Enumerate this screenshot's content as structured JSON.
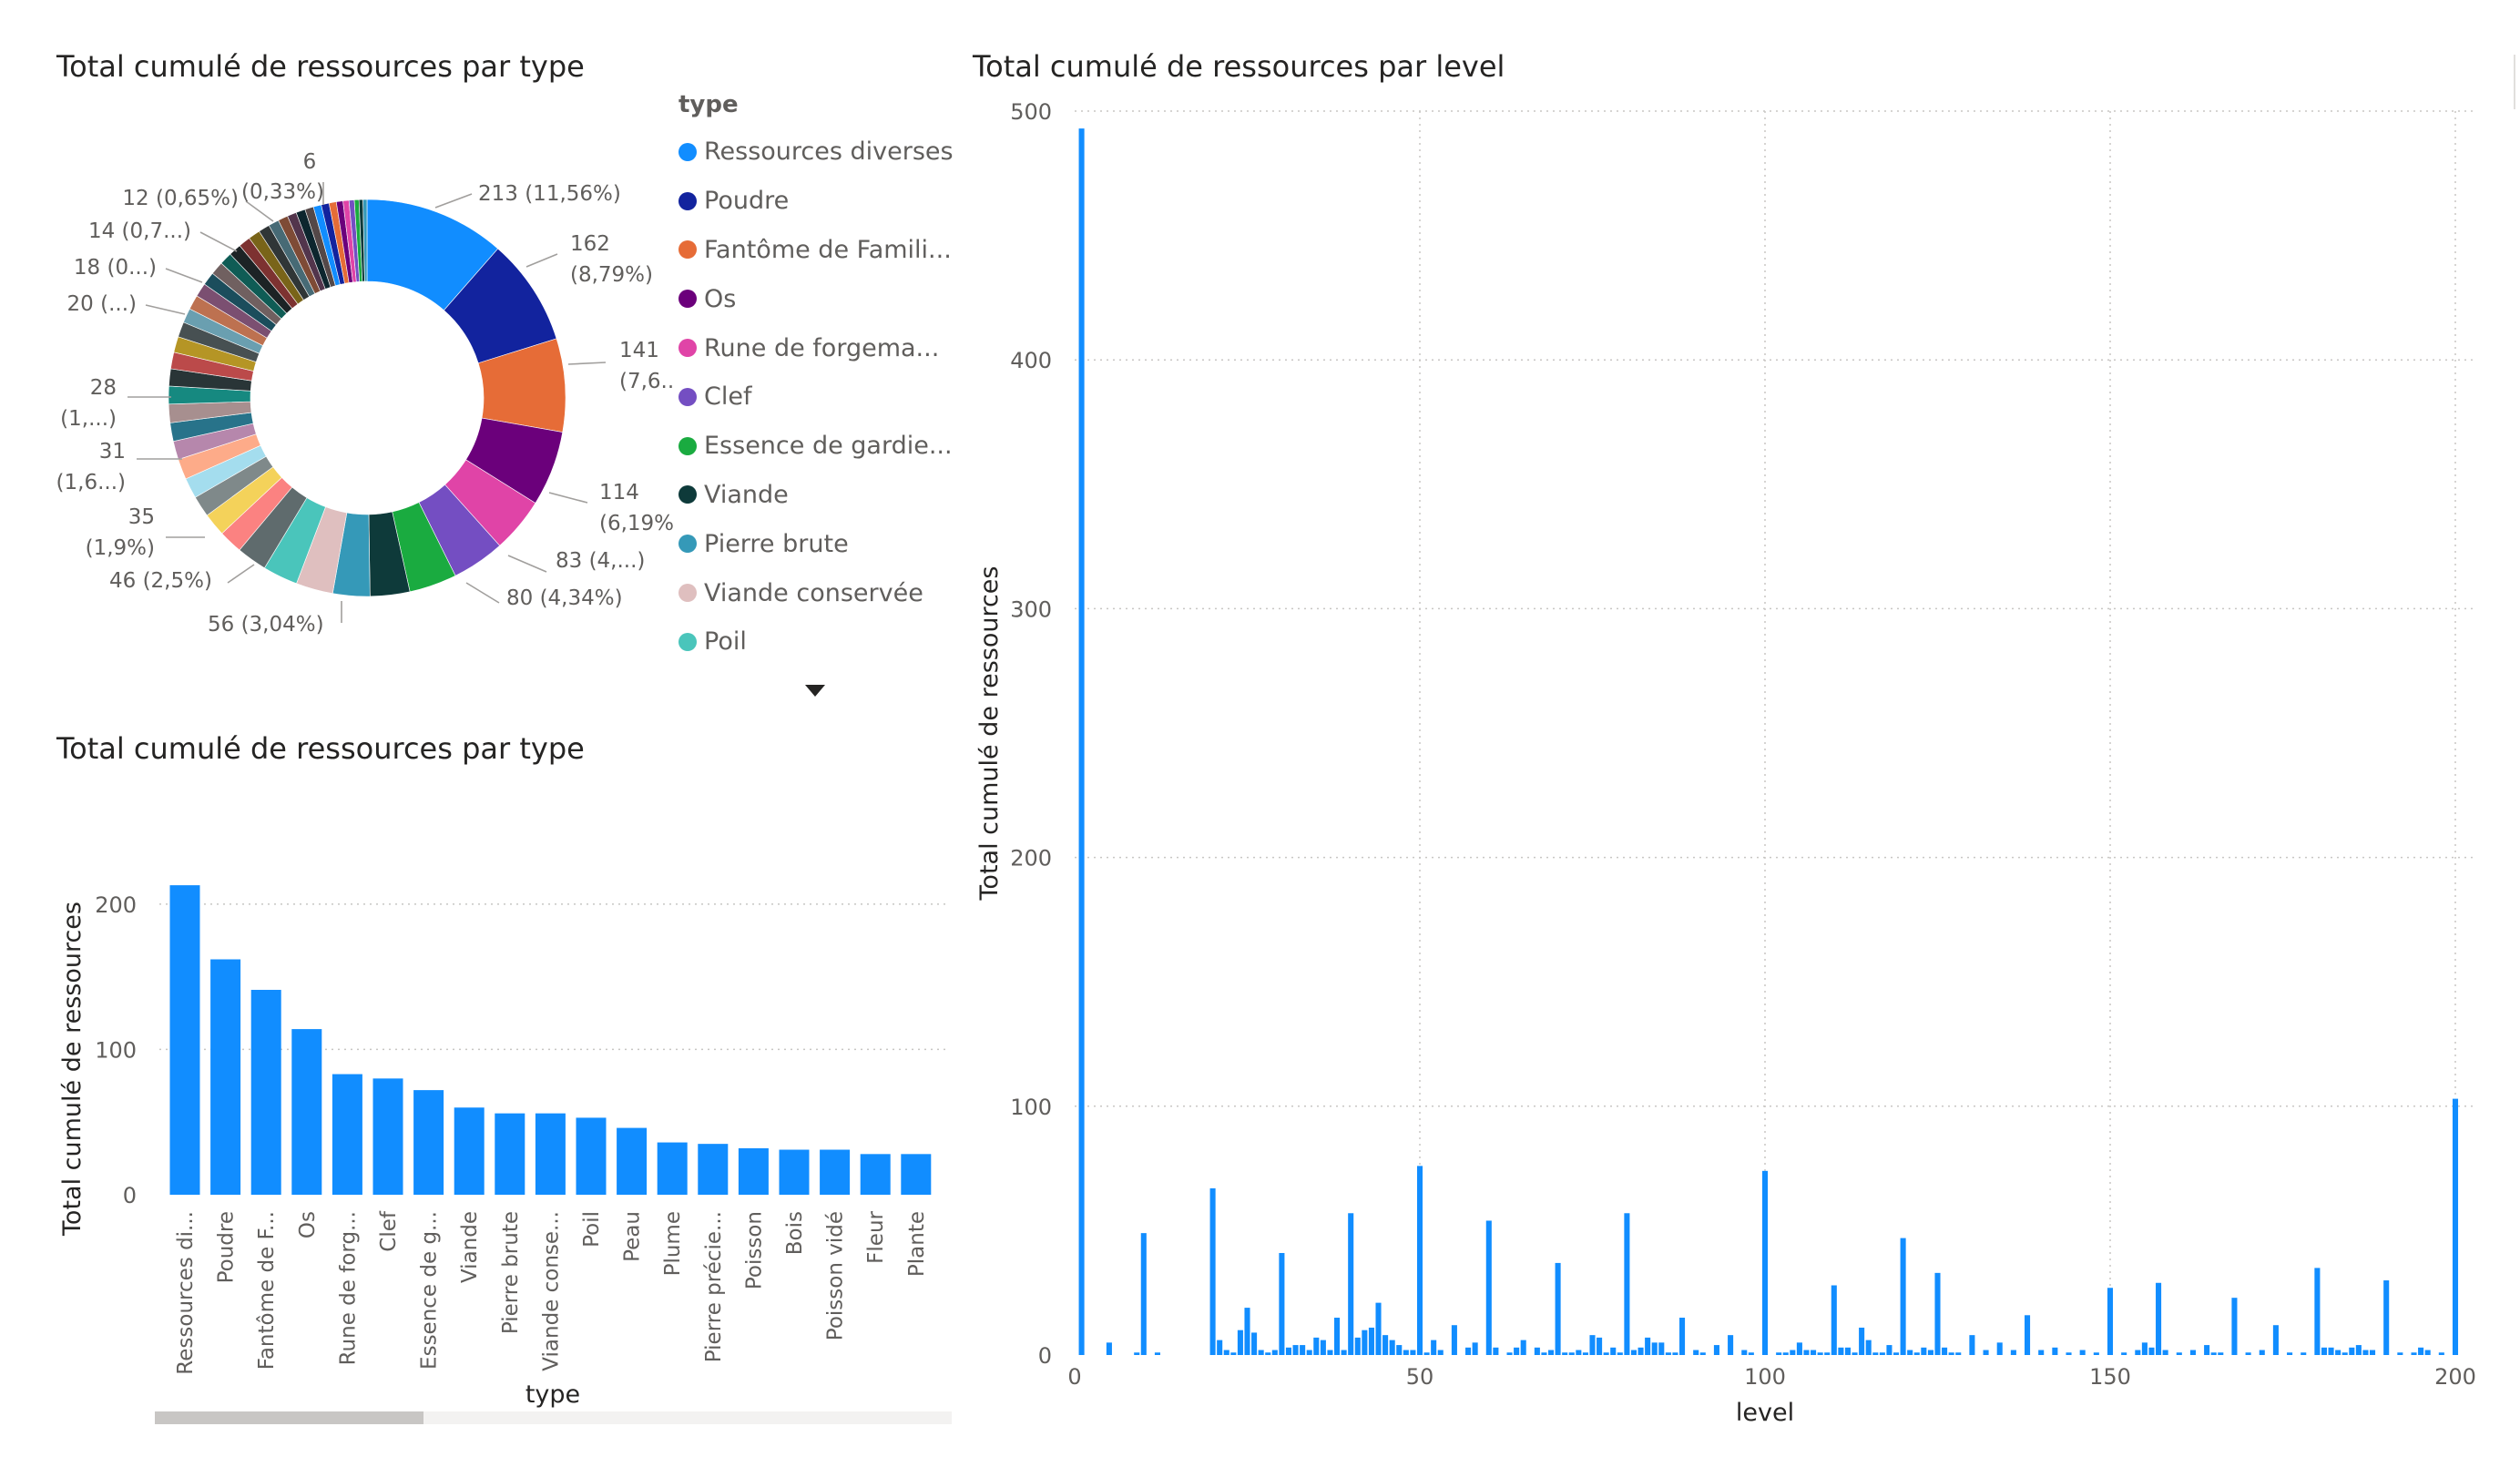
{
  "donut": {
    "title": "Total cumulé de ressources par type",
    "legend_title": "type",
    "legend_items": [
      {
        "label": "Ressources diverses",
        "color": "#118DFF"
      },
      {
        "label": "Poudre",
        "color": "#12239E"
      },
      {
        "label": "Fantôme de Famili...",
        "color": "#E66C37"
      },
      {
        "label": "Os",
        "color": "#6B007B"
      },
      {
        "label": "Rune de forgema...",
        "color": "#E044A7"
      },
      {
        "label": "Clef",
        "color": "#744EC2"
      },
      {
        "label": "Essence de gardie...",
        "color": "#1AAB40"
      },
      {
        "label": "Viande",
        "color": "#0E3A3A"
      },
      {
        "label": "Pierre brute",
        "color": "#3599B8"
      },
      {
        "label": "Viande conservée",
        "color": "#DFBFBF"
      },
      {
        "label": "Poil",
        "color": "#4AC5BB"
      }
    ],
    "labels": [
      {
        "lines": [
          "213 (11,56%)"
        ]
      },
      {
        "lines": [
          "162",
          "(8,79%)"
        ]
      },
      {
        "lines": [
          "141",
          "(7,6...)"
        ]
      },
      {
        "lines": [
          "114",
          "(6,19%)"
        ]
      },
      {
        "lines": [
          "83 (4,...)"
        ]
      },
      {
        "lines": [
          "80 (4,34%)"
        ]
      },
      {
        "lines": [
          "56 (3,04%)"
        ]
      },
      {
        "lines": [
          "46 (2,5%)"
        ]
      },
      {
        "lines": [
          "35",
          "(1,9%)"
        ]
      },
      {
        "lines": [
          "31",
          "(1,6...)"
        ]
      },
      {
        "lines": [
          "28",
          "(1,...)"
        ]
      },
      {
        "lines": [
          "20 (...)"
        ]
      },
      {
        "lines": [
          "18 (0...)"
        ]
      },
      {
        "lines": [
          "14 (0,7...)"
        ]
      },
      {
        "lines": [
          "12 (0,65%)"
        ]
      },
      {
        "lines": [
          "(0,33%)"
        ]
      },
      {
        "lines": [
          "6"
        ]
      }
    ]
  },
  "bar_type": {
    "title": "Total cumulé de ressources par type",
    "y_ticks": [
      "0",
      "100",
      "200"
    ]
  },
  "bar_level": {
    "title": "Total cumulé de ressources par level",
    "y_ticks": [
      "0",
      "100",
      "200",
      "300",
      "400",
      "500"
    ],
    "x_ticks": [
      "0",
      "50",
      "100",
      "150",
      "200"
    ]
  },
  "chart_data": [
    {
      "type": "pie",
      "title": "Total cumulé de ressources par type",
      "legend_title": "type",
      "categories": [
        "Ressources diverses",
        "Poudre",
        "Fantôme de Famili...",
        "Os",
        "Rune de forgema...",
        "Clef",
        "Essence de gardie...",
        "Viande",
        "Pierre brute",
        "Viande conservée",
        "Poil"
      ],
      "values": [
        213,
        162,
        141,
        114,
        83,
        80,
        72,
        60,
        56,
        56,
        53,
        46,
        36,
        35,
        32,
        31,
        31,
        28,
        28,
        28,
        27,
        26,
        25,
        24,
        23,
        22,
        22,
        21,
        20,
        20,
        19,
        19,
        18,
        18,
        17,
        16,
        15,
        14,
        14,
        13,
        12,
        12,
        11,
        10,
        9,
        8,
        7,
        6,
        6
      ],
      "colors": [
        "#118DFF",
        "#12239E",
        "#E66C37",
        "#6B007B",
        "#E044A7",
        "#744EC2",
        "#1AAB40",
        "#0E3A3A",
        "#3599B8",
        "#DFBFBF",
        "#4AC5BB",
        "#5F6B6D",
        "#FB8281",
        "#F4D25A",
        "#7F898A",
        "#A4DDEE",
        "#FDAB89",
        "#B687AC",
        "#28738A",
        "#A78F8F",
        "#168980",
        "#293537",
        "#BB4A4A",
        "#B59525",
        "#475052",
        "#6A9FB0",
        "#BD7150",
        "#7B4F71",
        "#1B4D5C",
        "#706060",
        "#0F5C55",
        "#1C2325",
        "#7D3231",
        "#796419",
        "#303637",
        "#476A75",
        "#7E4B36",
        "#52354C",
        "#0D262E",
        "#544848",
        "#118DFF",
        "#12239E",
        "#E66C37",
        "#6B007B",
        "#E044A7",
        "#744EC2",
        "#1AAB40",
        "#0E3A3A",
        "#3599B8"
      ]
    },
    {
      "type": "bar",
      "title": "Total cumulé de ressources par type",
      "xlabel": "type",
      "ylabel": "Total cumulé de ressources",
      "categories": [
        "Ressources di...",
        "Poudre",
        "Fantôme de F...",
        "Os",
        "Rune de forg...",
        "Clef",
        "Essence de g...",
        "Viande",
        "Pierre brute",
        "Viande conse...",
        "Poil",
        "Peau",
        "Plume",
        "Pierre précie...",
        "Poisson",
        "Bois",
        "Poisson vidé",
        "Fleur",
        "Plante"
      ],
      "values": [
        213,
        162,
        141,
        114,
        83,
        80,
        72,
        60,
        56,
        56,
        53,
        46,
        36,
        35,
        32,
        31,
        31,
        28,
        28
      ],
      "ylim": [
        0,
        230
      ],
      "color": "#118DFF",
      "grid": true
    },
    {
      "type": "bar",
      "title": "Total cumulé de ressources par level",
      "xlabel": "level",
      "ylabel": "Total cumulé de ressources",
      "x": [
        1,
        5,
        9,
        10,
        12,
        20,
        21,
        22,
        23,
        24,
        25,
        26,
        27,
        28,
        29,
        30,
        31,
        32,
        33,
        34,
        35,
        36,
        37,
        38,
        39,
        40,
        41,
        42,
        43,
        44,
        45,
        46,
        47,
        48,
        49,
        50,
        51,
        52,
        53,
        55,
        57,
        58,
        60,
        61,
        63,
        64,
        65,
        67,
        68,
        69,
        70,
        71,
        72,
        73,
        74,
        75,
        76,
        77,
        78,
        79,
        80,
        81,
        82,
        83,
        84,
        85,
        86,
        87,
        88,
        90,
        91,
        93,
        95,
        97,
        98,
        100,
        102,
        103,
        104,
        105,
        106,
        107,
        108,
        109,
        110,
        111,
        112,
        113,
        114,
        115,
        116,
        117,
        118,
        119,
        120,
        121,
        122,
        123,
        124,
        125,
        126,
        127,
        128,
        130,
        132,
        134,
        136,
        138,
        140,
        142,
        144,
        146,
        148,
        150,
        152,
        154,
        155,
        156,
        157,
        158,
        160,
        162,
        164,
        165,
        166,
        168,
        170,
        172,
        174,
        176,
        178,
        180,
        181,
        182,
        183,
        184,
        185,
        186,
        187,
        188,
        190,
        192,
        194,
        195,
        196,
        198,
        200
      ],
      "values": [
        493,
        5,
        1,
        49,
        1,
        67,
        6,
        2,
        1,
        10,
        19,
        9,
        2,
        1,
        2,
        41,
        3,
        4,
        4,
        2,
        7,
        6,
        2,
        15,
        2,
        57,
        7,
        10,
        11,
        21,
        8,
        6,
        4,
        2,
        2,
        76,
        1,
        6,
        2,
        12,
        3,
        5,
        54,
        3,
        1,
        3,
        6,
        3,
        1,
        2,
        37,
        1,
        1,
        2,
        1,
        8,
        7,
        1,
        3,
        1,
        57,
        2,
        3,
        7,
        5,
        5,
        1,
        1,
        15,
        2,
        1,
        4,
        8,
        2,
        1,
        74,
        1,
        1,
        2,
        5,
        2,
        2,
        1,
        1,
        28,
        3,
        3,
        1,
        11,
        6,
        1,
        1,
        4,
        1,
        47,
        2,
        1,
        3,
        2,
        33,
        3,
        1,
        1,
        8,
        2,
        5,
        2,
        16,
        2,
        3,
        1,
        2,
        1,
        27,
        1,
        2,
        5,
        3,
        29,
        2,
        1,
        2,
        4,
        1,
        1,
        23,
        1,
        2,
        12,
        1,
        1,
        35,
        3,
        3,
        2,
        1,
        3,
        4,
        2,
        2,
        30,
        1,
        1,
        3,
        2,
        1,
        103
      ],
      "xlim": [
        0,
        200
      ],
      "ylim": [
        0,
        500
      ],
      "color": "#118DFF",
      "grid": true
    }
  ]
}
